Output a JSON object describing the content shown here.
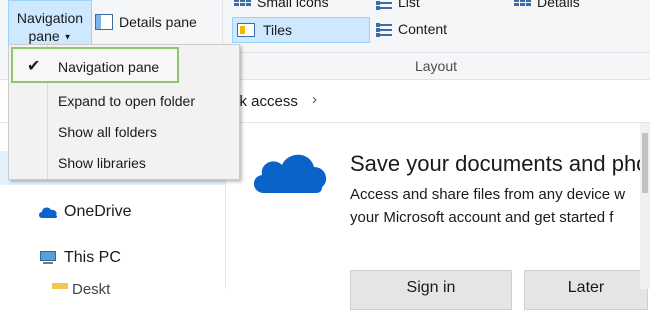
{
  "ribbon": {
    "navigation_pane_button": [
      "Navigation",
      "pane"
    ],
    "details_pane_button": "Details pane",
    "layout_items": {
      "small_icons": "Small icons",
      "list": "List",
      "details": "Details",
      "tiles": "Tiles",
      "content": "Content"
    },
    "group_label": "Layout"
  },
  "menu": {
    "items": [
      {
        "label": "Navigation pane",
        "checked": true
      },
      {
        "label": "Expand to open folder",
        "checked": false
      },
      {
        "label": "Show all folders",
        "checked": false
      },
      {
        "label": "Show libraries",
        "checked": false
      }
    ],
    "check_glyph": "✔"
  },
  "address": {
    "breadcrumb": "ck access",
    "chevron": "›"
  },
  "nav_tree": {
    "items": [
      "OneDrive",
      "This PC",
      "Deskt"
    ]
  },
  "main": {
    "title": "Save your documents and pho",
    "body": [
      "Access and share files from any device w",
      "your Microsoft account and get started f"
    ],
    "buttons": {
      "sign_in": "Sign in",
      "later": "Later"
    }
  },
  "colors": {
    "selection": "#cde8ff",
    "selection_border": "#99d1ff",
    "onedrive_blue": "#0a63c9",
    "highlight_green": "#8dc66b"
  }
}
